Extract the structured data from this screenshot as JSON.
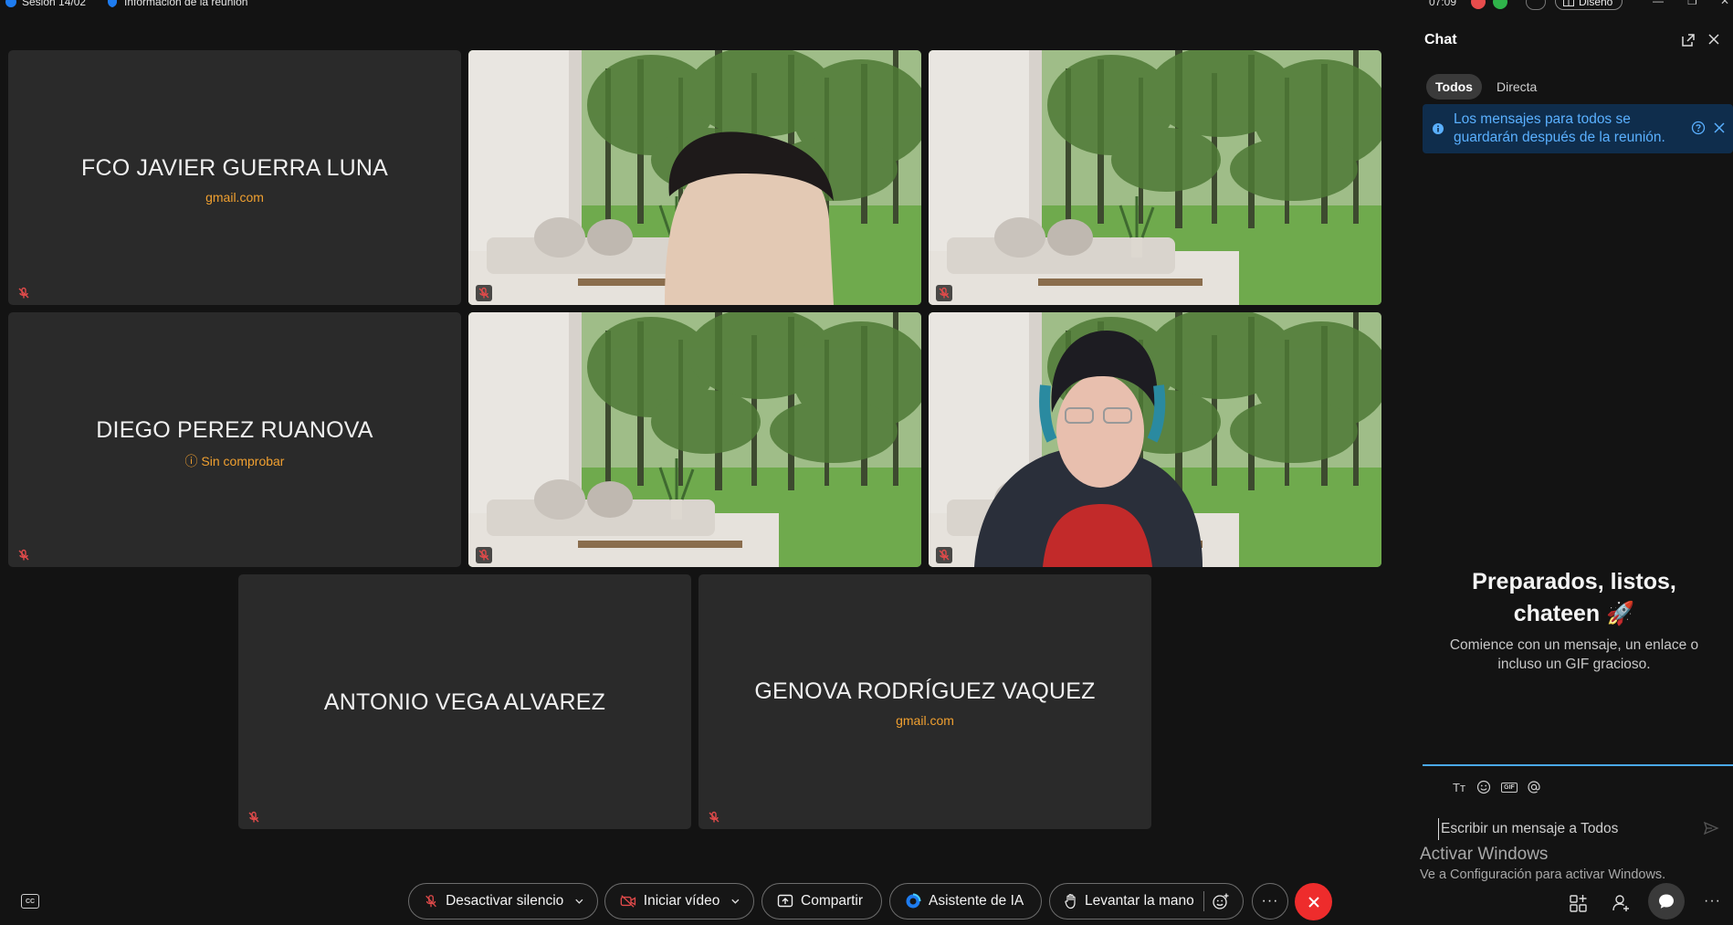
{
  "topbar": {
    "session": "Sesión 14/02",
    "meeting_info": "Información de la reunión",
    "time": "07:09",
    "layout_label": "Diseño"
  },
  "tiles": [
    {
      "name": "FCO JAVIER GUERRA LUNA",
      "sub": "gmail.com",
      "type": "avatar"
    },
    {
      "type": "video"
    },
    {
      "type": "video"
    },
    {
      "name": "DIEGO PEREZ RUANOVA",
      "sub": "Sin comprobar",
      "sub_icon": "question-circle-icon",
      "type": "avatar"
    },
    {
      "type": "video"
    },
    {
      "type": "video"
    },
    {
      "name": "ANTONIO VEGA ALVAREZ",
      "type": "avatar"
    },
    {
      "name": "GENOVA RODRÍGUEZ VAQUEZ",
      "sub": "gmail.com",
      "type": "avatar"
    }
  ],
  "chat": {
    "title": "Chat",
    "tabs": [
      {
        "label": "Todos",
        "active": true
      },
      {
        "label": "Directa",
        "active": false
      }
    ],
    "notice": "Los mensajes para todos se guardarán después de la reunión.",
    "empty_title_line1": "Preparados, listos,",
    "empty_title_line2": "chateen 🚀",
    "empty_sub": "Comience con un mensaje, un enlace o incluso un GIF gracioso.",
    "format_tools": [
      "text-format-icon",
      "emoji-icon",
      "gif-icon",
      "mention-icon"
    ],
    "format_text_label": "Tт",
    "gif_label": "GIF",
    "input_placeholder": "Escribir un mensaje a Todos"
  },
  "watermark": {
    "title": "Activar Windows",
    "sub": "Ve a Configuración para activar Windows."
  },
  "controls": {
    "mute_label": "Desactivar silencio",
    "video_label": "Iniciar vídeo",
    "share_label": "Compartir",
    "ai_label": "Asistente de IA",
    "raise_hand_label": "Levantar la mano",
    "more_label": "···",
    "cc_label": "CC"
  },
  "colors": {
    "accent_blue": "#4aa8e8",
    "notice_bg": "#0f2d4c",
    "notice_text": "#5ab0ff",
    "email_orange": "#f0a030",
    "hangup_red": "#ee2c2c",
    "muted_red": "#e04a4a"
  }
}
